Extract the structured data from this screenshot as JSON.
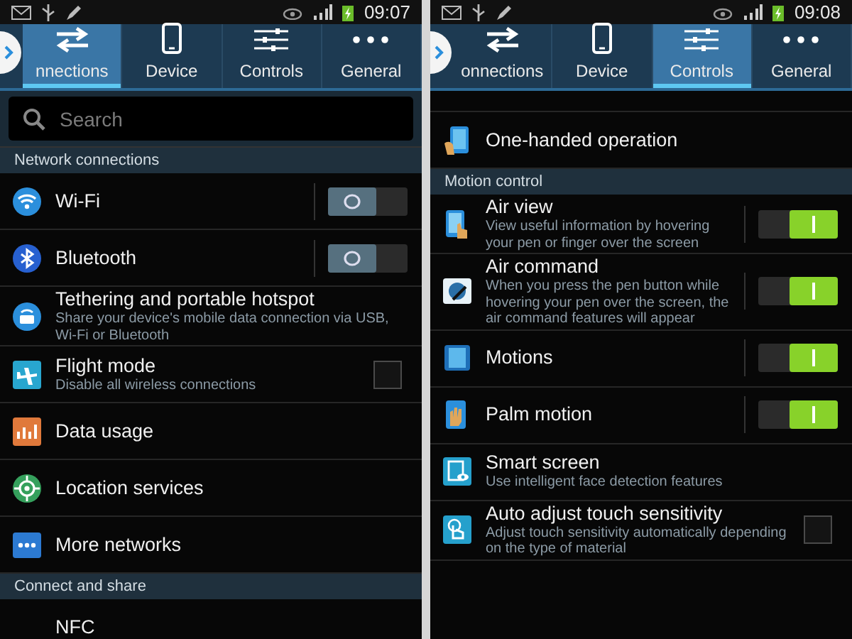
{
  "screens": [
    {
      "status_bar": {
        "time": "09:07"
      },
      "tabs": [
        {
          "label": "nnections",
          "selected": true
        },
        {
          "label": "Device",
          "selected": false
        },
        {
          "label": "Controls",
          "selected": false
        },
        {
          "label": "General",
          "selected": false
        }
      ],
      "items": [
        {
          "kind": "search",
          "placeholder": "Search"
        },
        {
          "kind": "header",
          "title": "Network connections"
        },
        {
          "kind": "toggle",
          "title": "Wi-Fi",
          "on": false
        },
        {
          "kind": "toggle",
          "title": "Bluetooth",
          "on": false
        },
        {
          "kind": "plain",
          "title": "Tethering and portable hotspot",
          "subtitle": "Share your device's mobile data connection via USB, Wi-Fi or Bluetooth"
        },
        {
          "kind": "checkbox",
          "title": "Flight mode",
          "subtitle": "Disable all wireless connections",
          "checked": false
        },
        {
          "kind": "plain",
          "title": "Data usage"
        },
        {
          "kind": "plain",
          "title": "Location services"
        },
        {
          "kind": "plain",
          "title": "More networks"
        },
        {
          "kind": "header",
          "title": "Connect and share"
        },
        {
          "kind": "plain",
          "title": "NFC"
        }
      ]
    },
    {
      "status_bar": {
        "time": "09:08"
      },
      "tabs": [
        {
          "label": "onnections",
          "selected": false
        },
        {
          "label": "Device",
          "selected": false
        },
        {
          "label": "Controls",
          "selected": true
        },
        {
          "label": "General",
          "selected": false
        }
      ],
      "items": [
        {
          "kind": "spacer"
        },
        {
          "kind": "plain",
          "title": "One-handed operation"
        },
        {
          "kind": "header",
          "title": "Motion control"
        },
        {
          "kind": "toggle",
          "title": "Air view",
          "subtitle": "View useful information by hovering your pen or finger over the screen",
          "on": true
        },
        {
          "kind": "toggle",
          "title": "Air command",
          "subtitle": "When you press the pen button while hovering your pen over the screen, the air command features will appear",
          "on": true
        },
        {
          "kind": "toggle",
          "title": "Motions",
          "on": true
        },
        {
          "kind": "toggle",
          "title": "Palm motion",
          "on": true
        },
        {
          "kind": "plain",
          "title": "Smart screen",
          "subtitle": "Use intelligent face detection features"
        },
        {
          "kind": "checkbox",
          "title": "Auto adjust touch sensitivity",
          "subtitle": "Adjust touch sensitivity automatically depending on the type of material",
          "checked": false
        }
      ]
    }
  ]
}
